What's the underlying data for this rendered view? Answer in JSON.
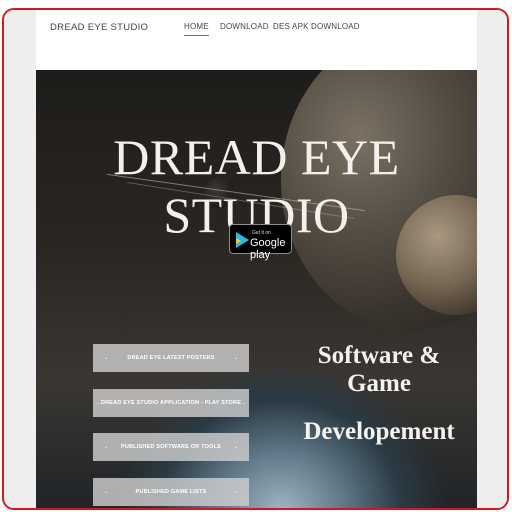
{
  "navbar": {
    "brand": "DREAD EYE STUDIO",
    "items": [
      {
        "label": "HOME",
        "active": true
      },
      {
        "label": "DOWNLOAD",
        "active": false
      },
      {
        "label": "DES APK DOWNLOAD",
        "active": false
      }
    ]
  },
  "hero": {
    "title": "DREAD EYE STUDIO",
    "play_badge": {
      "get_it_on": "Get it on",
      "store": "Google play"
    },
    "menu_buttons": [
      {
        "label": "DREAD EYE LATEST POSTERS"
      },
      {
        "label": ". DREAD EYE STUDIO APPLICATION - PLAY STORE ."
      },
      {
        "label": "PUBLISHED SOFTWARE OR TOOLS"
      },
      {
        "label": "PUBLISHED GAME LISTS"
      }
    ],
    "bullet": ".",
    "side_text": {
      "line1": "Software & Game",
      "line2": "Developement"
    }
  },
  "colors": {
    "frame_border": "#d11a1f",
    "accent_play": "#2fb7e8"
  }
}
